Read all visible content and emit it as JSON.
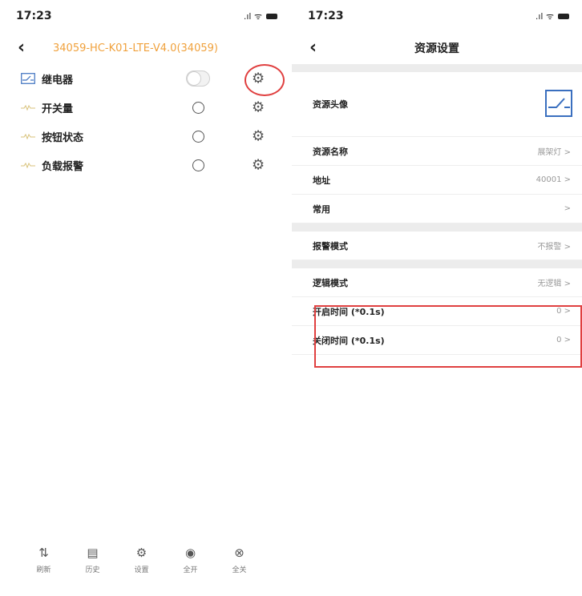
{
  "left": {
    "status": {
      "time": "17:23",
      "signal": ".ıl ᯤ"
    },
    "nav": {
      "title": "34059-HC-K01-LTE-V4.0(34059)"
    },
    "rows": [
      {
        "label": "继电器",
        "control": "toggle"
      },
      {
        "label": "开关量",
        "control": "radio"
      },
      {
        "label": "按钮状态",
        "control": "radio"
      },
      {
        "label": "负载报警",
        "control": "radio"
      }
    ],
    "tabs": [
      {
        "label": "刷新",
        "icon": "⇅"
      },
      {
        "label": "历史",
        "icon": "▤"
      },
      {
        "label": "设置",
        "icon": "⚙"
      },
      {
        "label": "全开",
        "icon": "◉"
      },
      {
        "label": "全关",
        "icon": "⊗"
      }
    ]
  },
  "right": {
    "status": {
      "time": "17:23",
      "signal": ".ıl ᯤ"
    },
    "nav": {
      "title": "资源设置"
    },
    "rows": {
      "avatar": {
        "label": "资源头像"
      },
      "name": {
        "label": "资源名称",
        "value": "展架灯 >"
      },
      "address": {
        "label": "地址",
        "value": "40001 >"
      },
      "common": {
        "label": "常用",
        "value": ">"
      },
      "alarm": {
        "label": "报警模式",
        "value": "不报警 >"
      },
      "logic": {
        "label": "逻辑模式",
        "value": "无逻辑 >"
      },
      "open_time": {
        "label": "开启时间 (*0.1s)",
        "value": "0 >"
      },
      "close_time": {
        "label": "关闭时间 (*0.1s)",
        "value": "0 >"
      }
    }
  },
  "colors": {
    "accent": "#f0a13c",
    "highlight": "#e04040",
    "relay_icon": "#3a6fbf"
  }
}
